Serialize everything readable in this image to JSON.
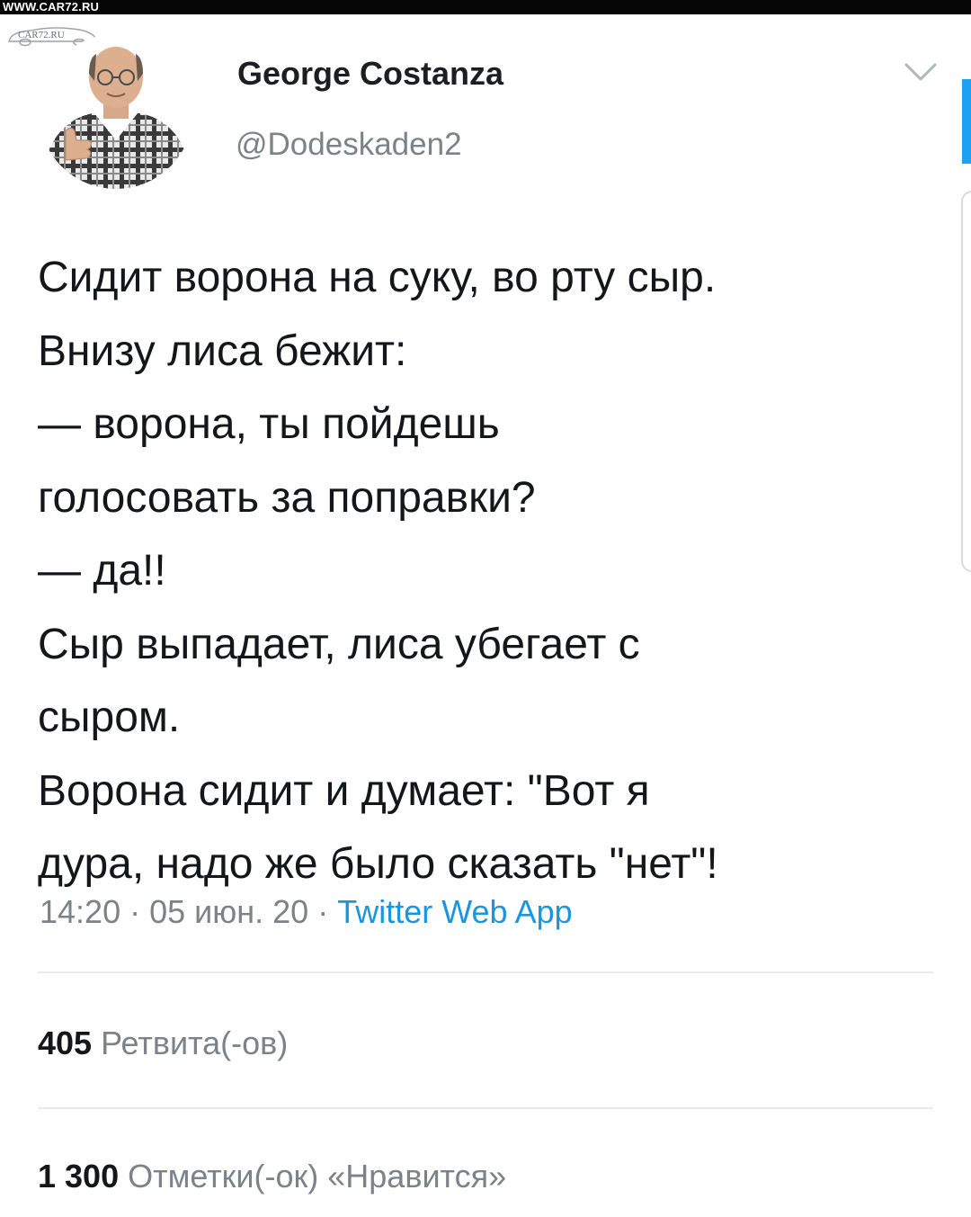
{
  "watermark": {
    "url_text": "WWW.CAR72.RU",
    "logo_text": "CAR72.RU"
  },
  "tweet": {
    "author_name": "George Costanza",
    "author_handle": "@Dodeskaden2",
    "text_lines": [
      "Сидит ворона на суку, во рту сыр.",
      "Внизу лиса бежит:",
      "— ворона, ты пойдешь",
      "голосовать за поправки?",
      "— да!!",
      "Сыр выпадает, лиса убегает с",
      "сыром.",
      "Ворона сидит и думает: \"Вот я",
      "дура, надо же было сказать \"нет\"!"
    ],
    "time": "14:20",
    "date": "05 июн. 20",
    "separator": " · ",
    "source": "Twitter Web App"
  },
  "stats": {
    "retweets_count": "405",
    "retweets_label": "Ретвита(-ов)",
    "likes_count": "1 300",
    "likes_label": "Отметки(-ок) «Нравится»"
  },
  "icons": {
    "menu": "chevron-down-icon",
    "avatar": "profile-photo"
  },
  "colors": {
    "link": "#1b95e0",
    "secondary_text": "#7b8288",
    "primary_text": "#14171a",
    "accent_bar": "#1da1f2",
    "divider": "#e6ecf0"
  }
}
